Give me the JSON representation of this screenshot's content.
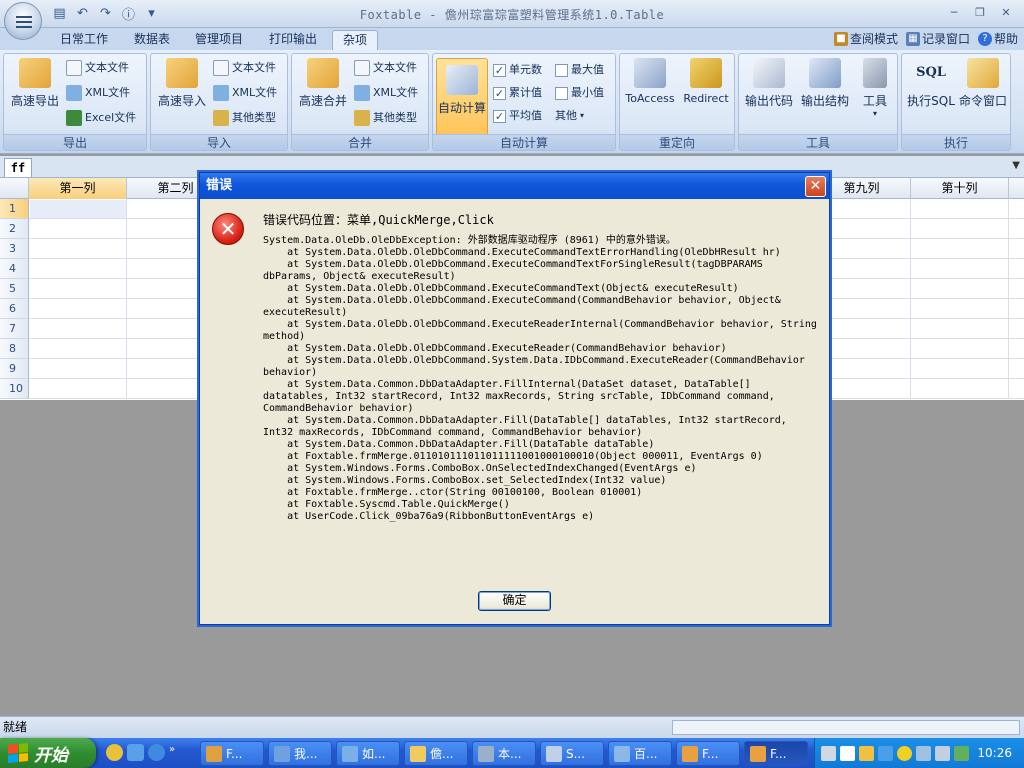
{
  "app": {
    "title": "Foxtable - 儋州琮富琮富塑料管理系统1.0.Table",
    "menu_tabs": [
      "日常工作",
      "数据表",
      "管理项目",
      "打印输出",
      "杂项"
    ],
    "active_tab": "杂项",
    "right_links": [
      "查阅模式",
      "记录窗口",
      "帮助"
    ]
  },
  "ribbon": {
    "groups": {
      "export": {
        "label": "导出",
        "big": "高速导出",
        "items": [
          "文本文件",
          "XML文件",
          "Excel文件"
        ]
      },
      "import": {
        "label": "导入",
        "big": "高速导入",
        "items": [
          "文本文件",
          "XML文件",
          "其他类型"
        ]
      },
      "merge": {
        "label": "合并",
        "big": "高速合并",
        "items": [
          "文本文件",
          "XML文件",
          "其他类型"
        ]
      },
      "autocalc": {
        "label": "自动计算",
        "big": "自动计算",
        "checks": [
          {
            "label": "单元数",
            "checked": true
          },
          {
            "label": "最大值",
            "checked": false
          },
          {
            "label": "累计值",
            "checked": true
          },
          {
            "label": "最小值",
            "checked": false
          },
          {
            "label": "平均值",
            "checked": true
          }
        ],
        "other": "其他"
      },
      "redirect": {
        "label": "重定向",
        "btn1": "ToAccess",
        "btn2": "Redirect"
      },
      "tools": {
        "label": "工具",
        "btn1": "输出代码",
        "btn2": "输出结构",
        "btn3": "工具"
      },
      "execute": {
        "label": "执行",
        "btn1": "执行SQL",
        "btn2": "命令窗口",
        "sql_icon": "SQL"
      }
    }
  },
  "doc_tab": "ff",
  "grid": {
    "columns": [
      "第一列",
      "第二列",
      "",
      "",
      "",
      "",
      "",
      "",
      "第九列",
      "第十列"
    ],
    "rows": [
      "1",
      "2",
      "3",
      "4",
      "5",
      "6",
      "7",
      "8",
      "9",
      "10"
    ]
  },
  "dialog": {
    "title": "错误",
    "location": "错误代码位置：菜单,QuickMerge,Click",
    "message": "System.Data.OleDb.OleDbException: 外部数据库驱动程序 (8961) 中的意外错误。\n    at System.Data.OleDb.OleDbCommand.ExecuteCommandTextErrorHandling(OleDbHResult hr)\n    at System.Data.OleDb.OleDbCommand.ExecuteCommandTextForSingleResult(tagDBPARAMS dbParams, Object& executeResult)\n    at System.Data.OleDb.OleDbCommand.ExecuteCommandText(Object& executeResult)\n    at System.Data.OleDb.OleDbCommand.ExecuteCommand(CommandBehavior behavior, Object& executeResult)\n    at System.Data.OleDb.OleDbCommand.ExecuteReaderInternal(CommandBehavior behavior, String method)\n    at System.Data.OleDb.OleDbCommand.ExecuteReader(CommandBehavior behavior)\n    at System.Data.OleDb.OleDbCommand.System.Data.IDbCommand.ExecuteReader(CommandBehavior behavior)\n    at System.Data.Common.DbDataAdapter.FillInternal(DataSet dataset, DataTable[] datatables, Int32 startRecord, Int32 maxRecords, String srcTable, IDbCommand command, CommandBehavior behavior)\n    at System.Data.Common.DbDataAdapter.Fill(DataTable[] dataTables, Int32 startRecord, Int32 maxRecords, IDbCommand command, CommandBehavior behavior)\n    at System.Data.Common.DbDataAdapter.Fill(DataTable dataTable)\n    at Foxtable.frmMerge.011010111011011111001000100010(Object 000011, EventArgs 0)\n    at System.Windows.Forms.ComboBox.OnSelectedIndexChanged(EventArgs e)\n    at System.Windows.Forms.ComboBox.set_SelectedIndex(Int32 value)\n    at Foxtable.frmMerge..ctor(String 00100100, Boolean 010001)\n    at Foxtable.Syscmd.Table.QuickMerge()\n    at UserCode.Click_09ba76a9(RibbonButtonEventArgs e)",
    "ok_label": "确定"
  },
  "status": {
    "text": "就绪"
  },
  "taskbar": {
    "start_label": "开始",
    "buttons": [
      "F...",
      "我...",
      "如...",
      "儋...",
      "本...",
      "S...",
      "百...",
      "F...",
      "F..."
    ],
    "clock": "10:26"
  },
  "colors": {
    "accent": "#2459d1",
    "dialog_title": "#0f56d9",
    "error": "#d71f13",
    "selected": "#f8cf7c"
  }
}
